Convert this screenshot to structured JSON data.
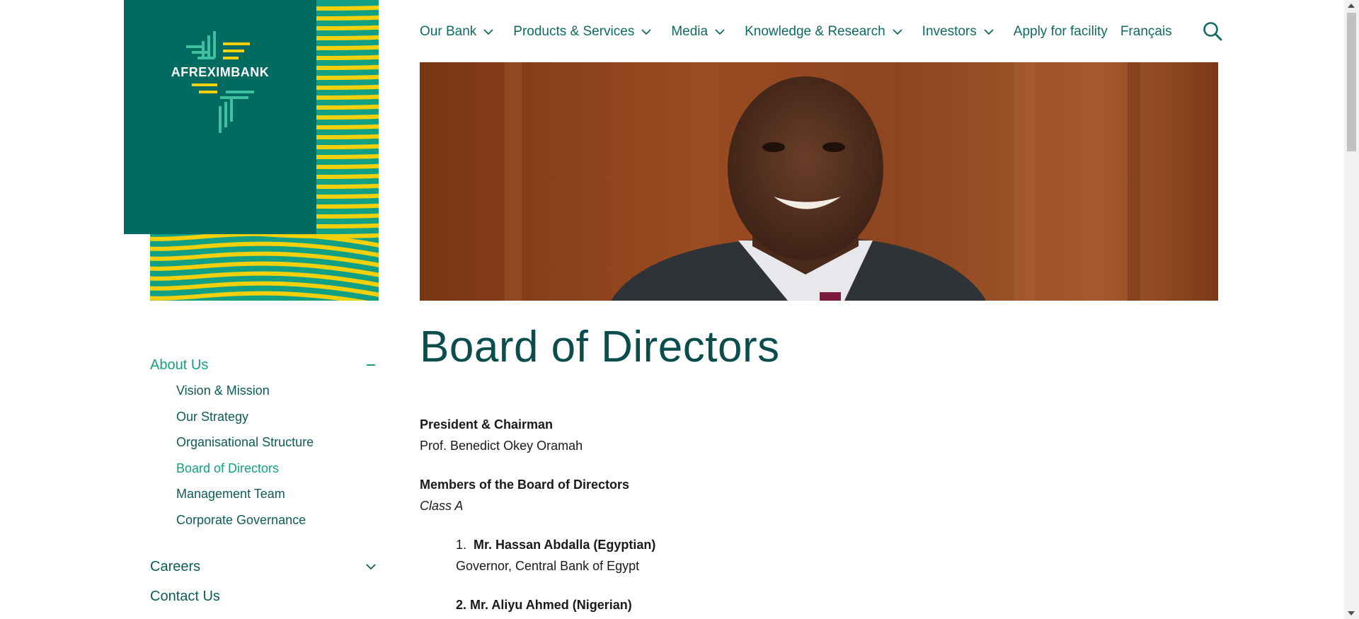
{
  "brand": {
    "name": "AFREXIMBANK",
    "logo_icon": "afreximbank-cross-icon",
    "colors": {
      "teal_dark": "#006b61",
      "teal": "#12a085",
      "yellow": "#f4d00b"
    }
  },
  "nav": {
    "items": [
      {
        "label": "Our Bank",
        "has_dropdown": true
      },
      {
        "label": "Products & Services",
        "has_dropdown": true
      },
      {
        "label": "Media",
        "has_dropdown": true
      },
      {
        "label": "Knowledge & Research",
        "has_dropdown": true
      },
      {
        "label": "Investors",
        "has_dropdown": true
      },
      {
        "label": "Apply for facility",
        "has_dropdown": false
      },
      {
        "label": "Français",
        "has_dropdown": false
      }
    ],
    "search_icon": "search-icon"
  },
  "hero": {
    "image": "portrait-photo"
  },
  "page": {
    "title": "Board of Directors"
  },
  "sidebar": {
    "about": {
      "label": "About Us",
      "expanded": true,
      "items": [
        {
          "label": "Vision & Mission",
          "active": false
        },
        {
          "label": "Our Strategy",
          "active": false
        },
        {
          "label": "Organisational Structure",
          "active": false
        },
        {
          "label": "Board of Directors",
          "active": true
        },
        {
          "label": "Management Team",
          "active": false
        },
        {
          "label": "Corporate Governance",
          "active": false
        }
      ]
    },
    "careers": {
      "label": "Careers"
    },
    "contact": {
      "label": "Contact Us"
    }
  },
  "content": {
    "president_heading": "President & Chairman",
    "president_name": "Prof. Benedict Okey Oramah",
    "members_heading": "Members of the Board of Directors",
    "class_label": "Class A",
    "members": [
      {
        "number": "1.",
        "name": "Mr. Hassan Abdalla (Egyptian)",
        "role": "Governor, Central Bank of Egypt"
      },
      {
        "number": "2.",
        "name": "Mr. Aliyu Ahmed (Nigerian)",
        "role": ""
      }
    ]
  }
}
